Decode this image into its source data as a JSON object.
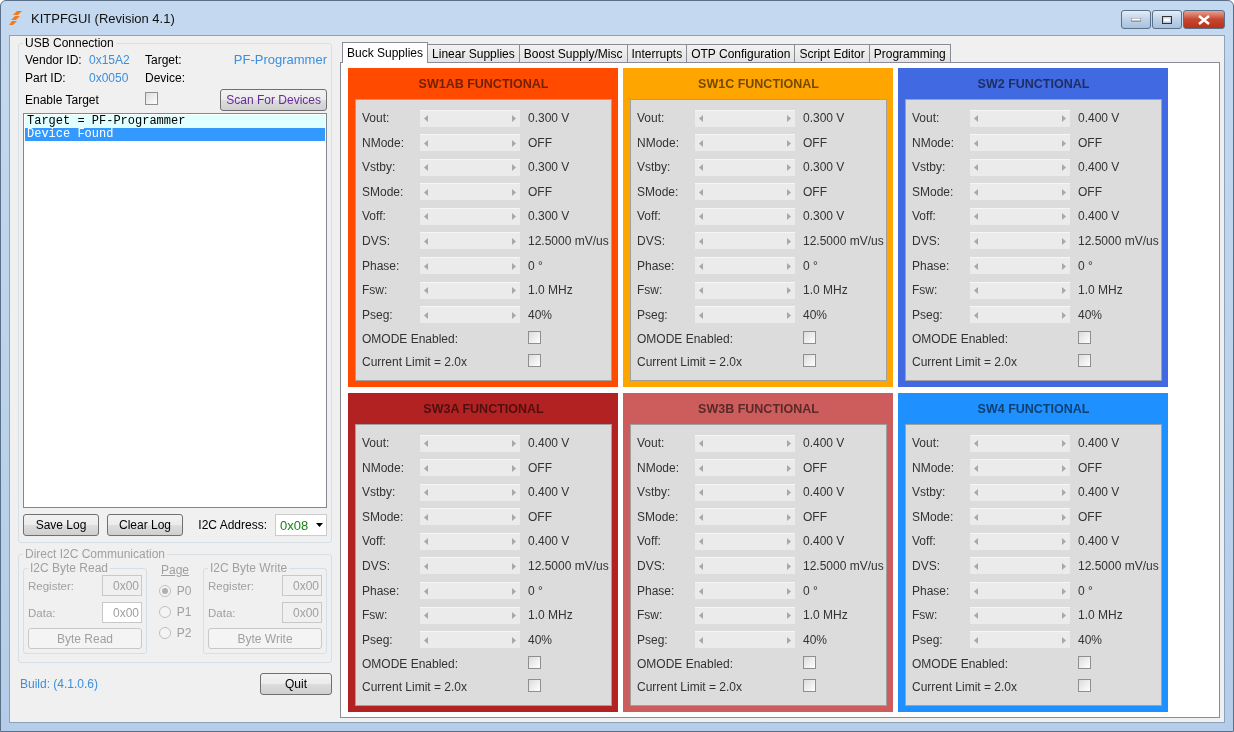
{
  "window": {
    "title": "KITPFGUI (Revision 4.1)"
  },
  "usb": {
    "title": "USB Connection",
    "vendor_label": "Vendor ID:",
    "vendor_value": "0x15A2",
    "target_label": "Target:",
    "target_value": "PF-Programmer",
    "part_label": "Part ID:",
    "part_value": "0x0050",
    "device_label": "Device:",
    "enable_label": "Enable Target",
    "enable_checked": false,
    "scan_button": "Scan For Devices"
  },
  "log": [
    {
      "text": "Target = PF-Programmer",
      "selected": false
    },
    {
      "text": "Device Found",
      "selected": true
    }
  ],
  "log_buttons": [
    "Save Log",
    "Clear Log"
  ],
  "i2c_address": {
    "label": "I2C Address:",
    "value": "0x08"
  },
  "direct": {
    "title": "Direct I2C Communication",
    "disabled": true,
    "read": {
      "title": "I2C Byte Read",
      "register_label": "Register:",
      "register_value": "0x00",
      "data_label": "Data:",
      "data_value": "0x00",
      "button": "Byte Read"
    },
    "page": {
      "title": "Page",
      "options": [
        {
          "label": "P0",
          "selected": true
        },
        {
          "label": "P1",
          "selected": false
        },
        {
          "label": "P2",
          "selected": false
        }
      ]
    },
    "write": {
      "title": "I2C Byte Write",
      "register_label": "Register:",
      "register_value": "0x00",
      "data_label": "Data:",
      "data_value": "0x00",
      "button": "Byte Write"
    }
  },
  "build": "Build: (4.1.0.6)",
  "quit_button": "Quit",
  "tabs": [
    {
      "label": "Buck Supplies",
      "selected": true
    },
    {
      "label": "Linear Supplies",
      "selected": false
    },
    {
      "label": "Boost Supply/Misc",
      "selected": false
    },
    {
      "label": "Interrupts",
      "selected": false
    },
    {
      "label": "OTP Configuration",
      "selected": false
    },
    {
      "label": "Script Editor",
      "selected": false
    },
    {
      "label": "Programming",
      "selected": false
    }
  ],
  "panels": [
    {
      "title": "SW1AB FUNCTIONAL",
      "color": "#ff4a00",
      "rows": [
        {
          "label": "Vout:",
          "value": "0.300 V"
        },
        {
          "label": "NMode:",
          "value": "OFF"
        },
        {
          "label": "Vstby:",
          "value": "0.300 V"
        },
        {
          "label": "SMode:",
          "value": "OFF"
        },
        {
          "label": "Voff:",
          "value": "0.300 V"
        },
        {
          "label": "DVS:",
          "value": "12.5000 mV/us"
        },
        {
          "label": "Phase:",
          "value": "0 °"
        },
        {
          "label": "Fsw:",
          "value": "1.0 MHz"
        },
        {
          "label": "Pseg:",
          "value": "40%"
        }
      ],
      "checks": [
        {
          "label": "OMODE Enabled:",
          "checked": false
        },
        {
          "label": "Current Limit = 2.0x",
          "checked": false
        }
      ]
    },
    {
      "title": "SW1C FUNCTIONAL",
      "color": "#ffa500",
      "rows": [
        {
          "label": "Vout:",
          "value": "0.300 V"
        },
        {
          "label": "NMode:",
          "value": "OFF"
        },
        {
          "label": "Vstby:",
          "value": "0.300 V"
        },
        {
          "label": "SMode:",
          "value": "OFF"
        },
        {
          "label": "Voff:",
          "value": "0.300 V"
        },
        {
          "label": "DVS:",
          "value": "12.5000 mV/us"
        },
        {
          "label": "Phase:",
          "value": "0 °"
        },
        {
          "label": "Fsw:",
          "value": "1.0 MHz"
        },
        {
          "label": "Pseg:",
          "value": "40%"
        }
      ],
      "checks": [
        {
          "label": "OMODE Enabled:",
          "checked": false
        },
        {
          "label": "Current Limit = 2.0x",
          "checked": false
        }
      ]
    },
    {
      "title": "SW2 FUNCTIONAL",
      "color": "#4169e1",
      "rows": [
        {
          "label": "Vout:",
          "value": "0.400 V"
        },
        {
          "label": "NMode:",
          "value": "OFF"
        },
        {
          "label": "Vstby:",
          "value": "0.400 V"
        },
        {
          "label": "SMode:",
          "value": "OFF"
        },
        {
          "label": "Voff:",
          "value": "0.400 V"
        },
        {
          "label": "DVS:",
          "value": "12.5000 mV/us"
        },
        {
          "label": "Phase:",
          "value": "0 °"
        },
        {
          "label": "Fsw:",
          "value": "1.0 MHz"
        },
        {
          "label": "Pseg:",
          "value": "40%"
        }
      ],
      "checks": [
        {
          "label": "OMODE Enabled:",
          "checked": false
        },
        {
          "label": "Current Limit = 2.0x",
          "checked": false
        }
      ]
    },
    {
      "title": "SW3A FUNCTIONAL",
      "color": "#b22222",
      "rows": [
        {
          "label": "Vout:",
          "value": "0.400 V"
        },
        {
          "label": "NMode:",
          "value": "OFF"
        },
        {
          "label": "Vstby:",
          "value": "0.400 V"
        },
        {
          "label": "SMode:",
          "value": "OFF"
        },
        {
          "label": "Voff:",
          "value": "0.400 V"
        },
        {
          "label": "DVS:",
          "value": "12.5000 mV/us"
        },
        {
          "label": "Phase:",
          "value": "0 °"
        },
        {
          "label": "Fsw:",
          "value": "1.0 MHz"
        },
        {
          "label": "Pseg:",
          "value": "40%"
        }
      ],
      "checks": [
        {
          "label": "OMODE Enabled:",
          "checked": false
        },
        {
          "label": "Current Limit = 2.0x",
          "checked": false
        }
      ]
    },
    {
      "title": "SW3B FUNCTIONAL",
      "color": "#cd5c5c",
      "rows": [
        {
          "label": "Vout:",
          "value": "0.400 V"
        },
        {
          "label": "NMode:",
          "value": "OFF"
        },
        {
          "label": "Vstby:",
          "value": "0.400 V"
        },
        {
          "label": "SMode:",
          "value": "OFF"
        },
        {
          "label": "Voff:",
          "value": "0.400 V"
        },
        {
          "label": "DVS:",
          "value": "12.5000 mV/us"
        },
        {
          "label": "Phase:",
          "value": "0 °"
        },
        {
          "label": "Fsw:",
          "value": "1.0 MHz"
        },
        {
          "label": "Pseg:",
          "value": "40%"
        }
      ],
      "checks": [
        {
          "label": "OMODE Enabled:",
          "checked": false
        },
        {
          "label": "Current Limit = 2.0x",
          "checked": false
        }
      ]
    },
    {
      "title": "SW4 FUNCTIONAL",
      "color": "#1e90ff",
      "rows": [
        {
          "label": "Vout:",
          "value": "0.400 V"
        },
        {
          "label": "NMode:",
          "value": "OFF"
        },
        {
          "label": "Vstby:",
          "value": "0.400 V"
        },
        {
          "label": "SMode:",
          "value": "OFF"
        },
        {
          "label": "Voff:",
          "value": "0.400 V"
        },
        {
          "label": "DVS:",
          "value": "12.5000 mV/us"
        },
        {
          "label": "Phase:",
          "value": "0 °"
        },
        {
          "label": "Fsw:",
          "value": "1.0 MHz"
        },
        {
          "label": "Pseg:",
          "value": "40%"
        }
      ],
      "checks": [
        {
          "label": "OMODE Enabled:",
          "checked": false
        },
        {
          "label": "Current Limit = 2.0x",
          "checked": false
        }
      ]
    }
  ]
}
